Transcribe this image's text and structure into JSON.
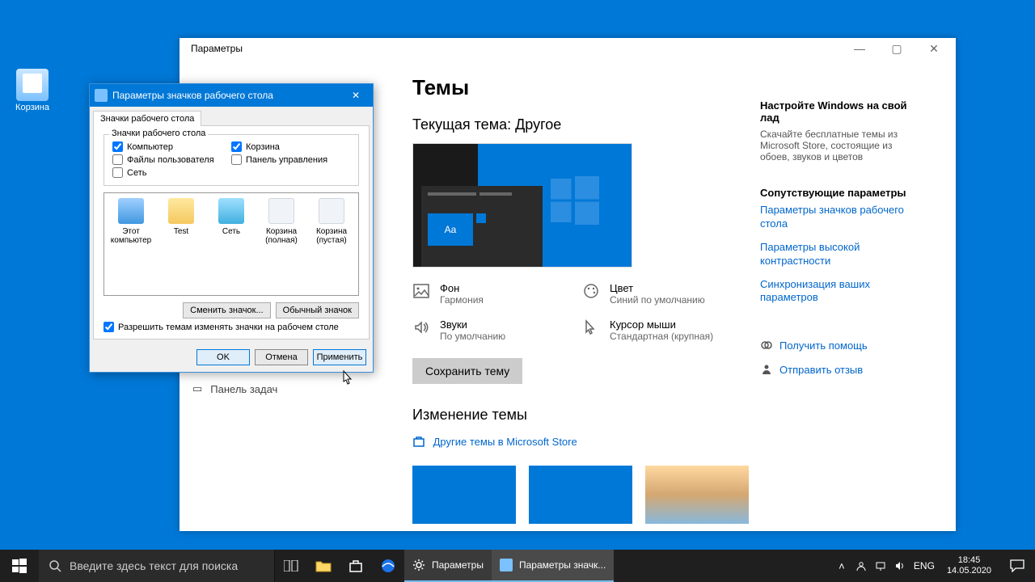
{
  "desktop": {
    "recycle_bin": "Корзина"
  },
  "settings": {
    "window_title": "Параметры",
    "page_title": "Темы",
    "current_theme_label": "Текущая тема: Другое",
    "props": {
      "background": {
        "title": "Фон",
        "value": "Гармония"
      },
      "color": {
        "title": "Цвет",
        "value": "Синий по умолчанию"
      },
      "sounds": {
        "title": "Звуки",
        "value": "По умолчанию"
      },
      "cursor": {
        "title": "Курсор мыши",
        "value": "Стандартная (крупная)"
      }
    },
    "save_theme": "Сохранить тему",
    "change_theme_h": "Изменение темы",
    "store_link": "Другие темы в Microsoft Store",
    "panel_taskbar_peek": "Панель задач"
  },
  "side": {
    "customize_h": "Настройте Windows на свой лад",
    "customize_p": "Скачайте бесплатные темы из Microsoft Store, состоящие из обоев, звуков и цветов",
    "related_h": "Сопутствующие параметры",
    "link_icons": "Параметры значков рабочего стола",
    "link_contrast": "Параметры высокой контрастности",
    "link_sync": "Синхронизация ваших параметров",
    "help": "Получить помощь",
    "feedback": "Отправить отзыв"
  },
  "dialog": {
    "title": "Параметры значков рабочего стола",
    "tab": "Значки рабочего стола",
    "fieldset": "Значки рабочего стола",
    "chk_computer": "Компьютер",
    "chk_recycle": "Корзина",
    "chk_userfiles": "Файлы пользователя",
    "chk_cpanel": "Панель управления",
    "chk_network": "Сеть",
    "icons": {
      "this_pc": "Этот компьютер",
      "user": "Test",
      "network": "Сеть",
      "bin_full": "Корзина (полная)",
      "bin_empty": "Корзина (пустая)"
    },
    "btn_change": "Сменить значок...",
    "btn_default": "Обычный значок",
    "allow_themes": "Разрешить темам изменять значки на рабочем столе",
    "ok": "OK",
    "cancel": "Отмена",
    "apply": "Применить"
  },
  "taskbar": {
    "search_placeholder": "Введите здесь текст для поиска",
    "task_settings": "Параметры",
    "task_dialog": "Параметры значк...",
    "lang": "ENG",
    "time": "18:45",
    "date": "14.05.2020"
  }
}
